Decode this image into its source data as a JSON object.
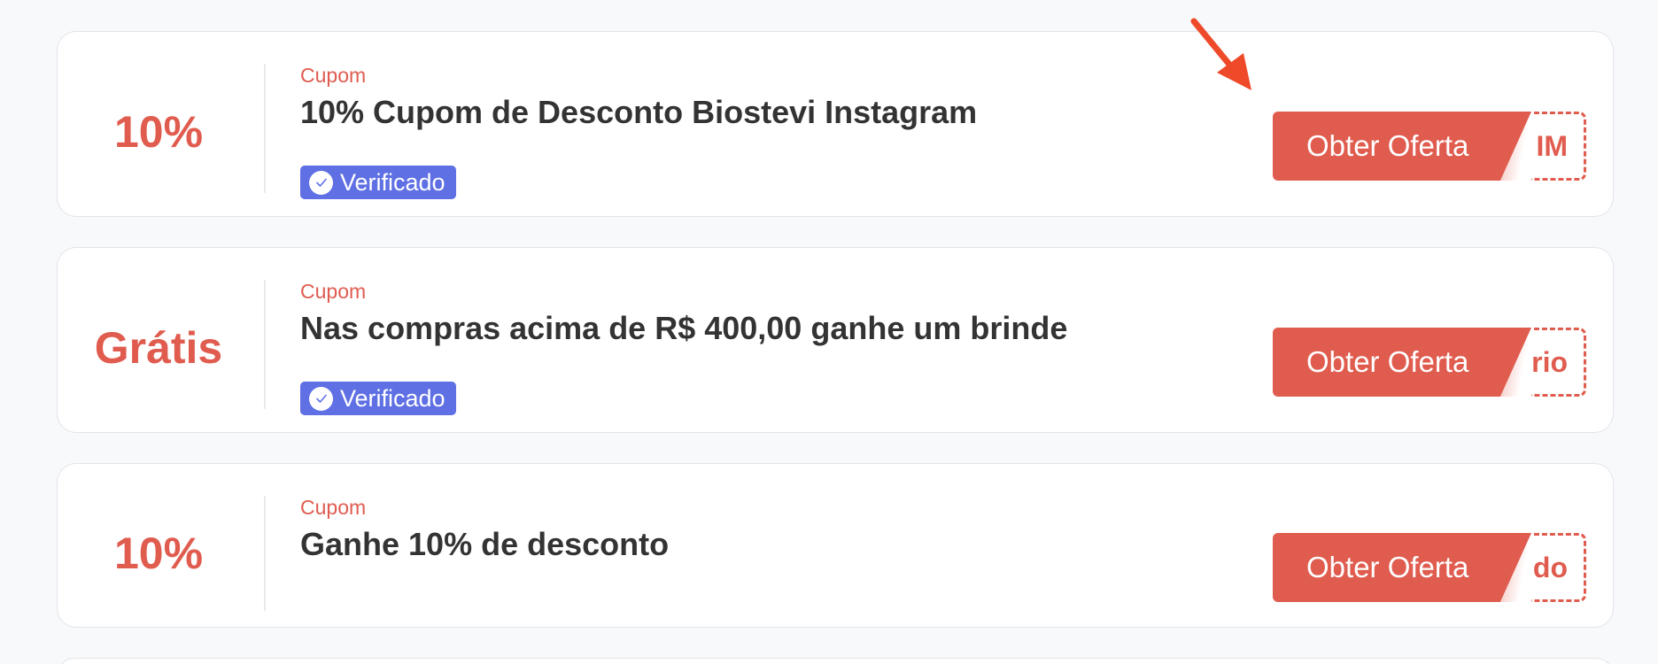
{
  "coupons": [
    {
      "discount": "10%",
      "type": "Cupom",
      "title": "10% Cupom de Desconto Biostevi Instagram",
      "verified": "Verificado",
      "button": "Obter Oferta",
      "code_peek": "IM"
    },
    {
      "discount": "Grátis",
      "type": "Cupom",
      "title": "Nas compras acima de R$ 400,00 ganhe um brinde",
      "verified": "Verificado",
      "button": "Obter Oferta",
      "code_peek": "rio"
    },
    {
      "discount": "10%",
      "type": "Cupom",
      "title": "Ganhe 10% de desconto",
      "button": "Obter Oferta",
      "code_peek": "do"
    }
  ],
  "colors": {
    "accent": "#e05c4f",
    "verified_badge": "#5f6fe4",
    "title_text": "#333333",
    "arrow": "#ee4a2a"
  },
  "icons": {
    "verified": "check-circle-icon",
    "pointer": "arrow-pointer-icon"
  }
}
